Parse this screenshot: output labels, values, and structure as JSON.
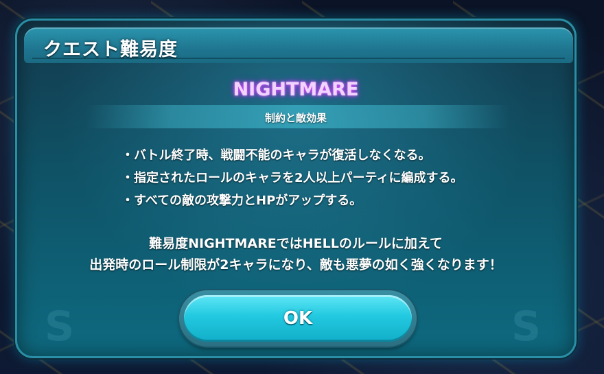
{
  "dialog": {
    "title": "クエスト難易度",
    "difficulty": "NIGHTMARE",
    "effect_label": "制約と敵効果",
    "rules": [
      "・バトル終了時、戦闘不能のキャラが復活しなくなる。",
      "・指定されたロールのキャラを2人以上パーティに編成する。",
      "・すべての敵の攻撃力とHPがアップする。"
    ],
    "description": [
      "難易度NIGHTMAREではHELLのルールに加えて",
      "出発時のロール制限が2キャラになり、敵も悪夢の如く強くなります！"
    ],
    "ok_label": "OK"
  },
  "colors": {
    "accent": "#22c9e0",
    "title_bar": "#2b95ae",
    "difficulty_glow": "#d04dff"
  }
}
